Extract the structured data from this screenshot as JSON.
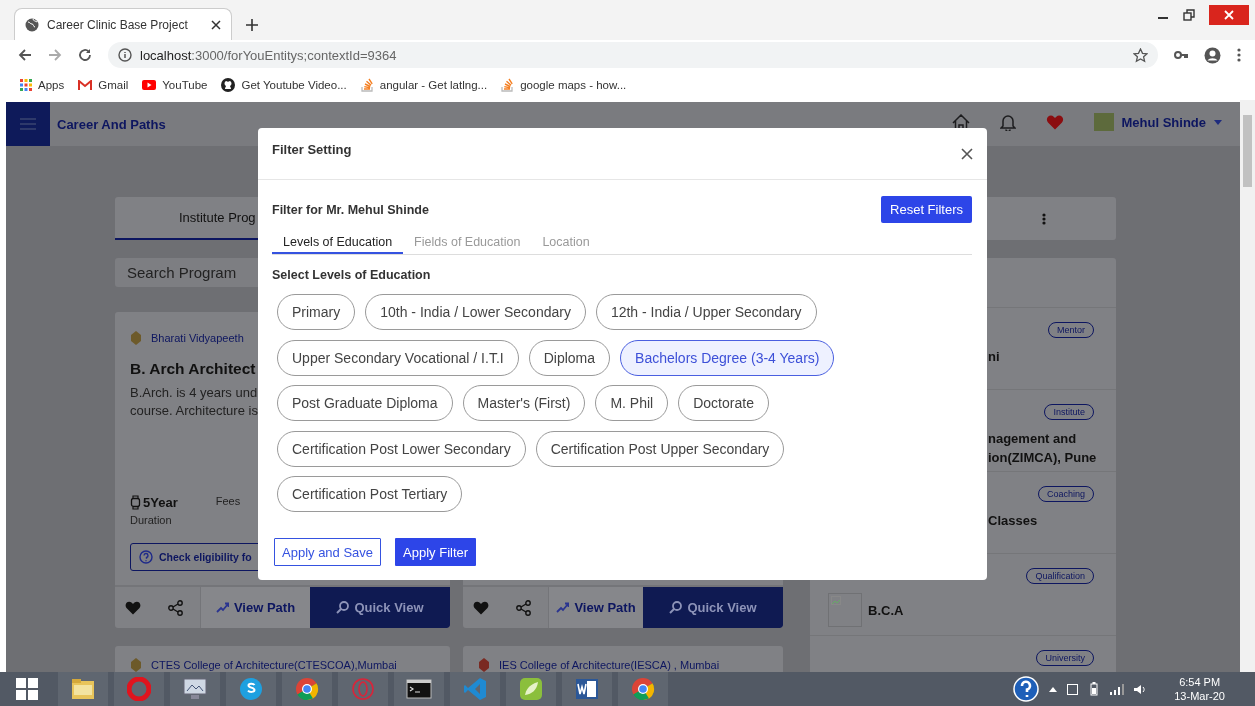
{
  "browser": {
    "tab_title": "Career Clinic Base Project",
    "url_host": "localhost",
    "url_rest": ":3000/forYouEntitys;contextId=9364",
    "bookmarks": [
      {
        "label": "Apps",
        "kind": "apps"
      },
      {
        "label": "Gmail",
        "kind": "gmail"
      },
      {
        "label": "YouTube",
        "kind": "youtube"
      },
      {
        "label": "Get Youtube Video...",
        "kind": "github"
      },
      {
        "label": "angular - Get latlng...",
        "kind": "stack"
      },
      {
        "label": "google maps - how...",
        "kind": "stack"
      }
    ]
  },
  "header": {
    "title": "Career And Paths",
    "user_name": "Mehul Shinde"
  },
  "programs": {
    "tab_label": "Institute Prog",
    "search_placeholder": "Search Program",
    "card": {
      "college": "Bharati Vidyapeeth",
      "title": "B. Arch Architect",
      "description_lines": [
        "B.Arch. is 4 years und",
        "course. Architecture is"
      ],
      "duration": "5Year",
      "duration_label": "Duration",
      "fees_label": "Fees",
      "eligibility_button": "Check eligibility fo"
    },
    "action_bars": [
      {
        "view_path": "View Path",
        "quick_view": "Quick View"
      },
      {
        "view_path": "View Path",
        "quick_view": "Quick View"
      }
    ],
    "next_cards": [
      {
        "college": "CTES College of Architecture(CTESCOA),Mumbai"
      },
      {
        "college": "IES College of Architecture(IESCA) , Mumbai"
      }
    ]
  },
  "side_list": {
    "items": [
      {
        "badge": "Mentor",
        "kind": "text",
        "lines": [
          "ni"
        ]
      },
      {
        "badge": "Institute",
        "kind": "text",
        "lines": [
          "nagement and",
          "ion(ZIMCA), Pune"
        ]
      },
      {
        "badge": "Coaching",
        "kind": "text",
        "lines": [
          "Classes"
        ]
      },
      {
        "badge": "Qualification",
        "kind": "image",
        "lines": [
          "B.C.A"
        ]
      },
      {
        "badge": "University",
        "kind": "text"
      }
    ]
  },
  "modal": {
    "title": "Filter Setting",
    "subtitle": "Filter for Mr. Mehul Shinde",
    "reset_button": "Reset Filters",
    "tabs": [
      {
        "label": "Levels of Education",
        "selected": true
      },
      {
        "label": "Fields of Education",
        "selected": false
      },
      {
        "label": "Location",
        "selected": false
      }
    ],
    "section_title": "Select Levels of Education",
    "option_rows": [
      [
        {
          "label": "Primary",
          "selected": false
        },
        {
          "label": "10th - India / Lower Secondary",
          "selected": false
        },
        {
          "label": "12th - India / Upper Secondary",
          "selected": false
        }
      ],
      [
        {
          "label": "Upper Secondary Vocational / I.T.I",
          "selected": false
        },
        {
          "label": "Diploma",
          "selected": false
        },
        {
          "label": "Bachelors Degree (3-4 Years)",
          "selected": true
        }
      ],
      [
        {
          "label": "Post Graduate Diploma",
          "selected": false
        },
        {
          "label": "Master's (First)",
          "selected": false
        },
        {
          "label": "M. Phil",
          "selected": false
        },
        {
          "label": "Doctorate",
          "selected": false
        }
      ],
      [
        {
          "label": "Certification Post Lower Secondary",
          "selected": false
        },
        {
          "label": "Certification Post Upper Secondary",
          "selected": false
        }
      ],
      [
        {
          "label": "Certification Post Tertiary",
          "selected": false
        }
      ]
    ],
    "apply_save_button": "Apply and Save",
    "apply_filter_button": "Apply Filter"
  },
  "taskbar": {
    "apps": [
      {
        "kind": "folder"
      },
      {
        "kind": "opera"
      },
      {
        "kind": "monitor"
      },
      {
        "kind": "skype"
      },
      {
        "kind": "chrome"
      },
      {
        "kind": "ring"
      },
      {
        "kind": "terminal"
      },
      {
        "kind": "code"
      },
      {
        "kind": "leaf"
      },
      {
        "kind": "word"
      },
      {
        "kind": "chrome"
      }
    ],
    "time": "6:54 PM",
    "date": "13-Mar-20"
  }
}
